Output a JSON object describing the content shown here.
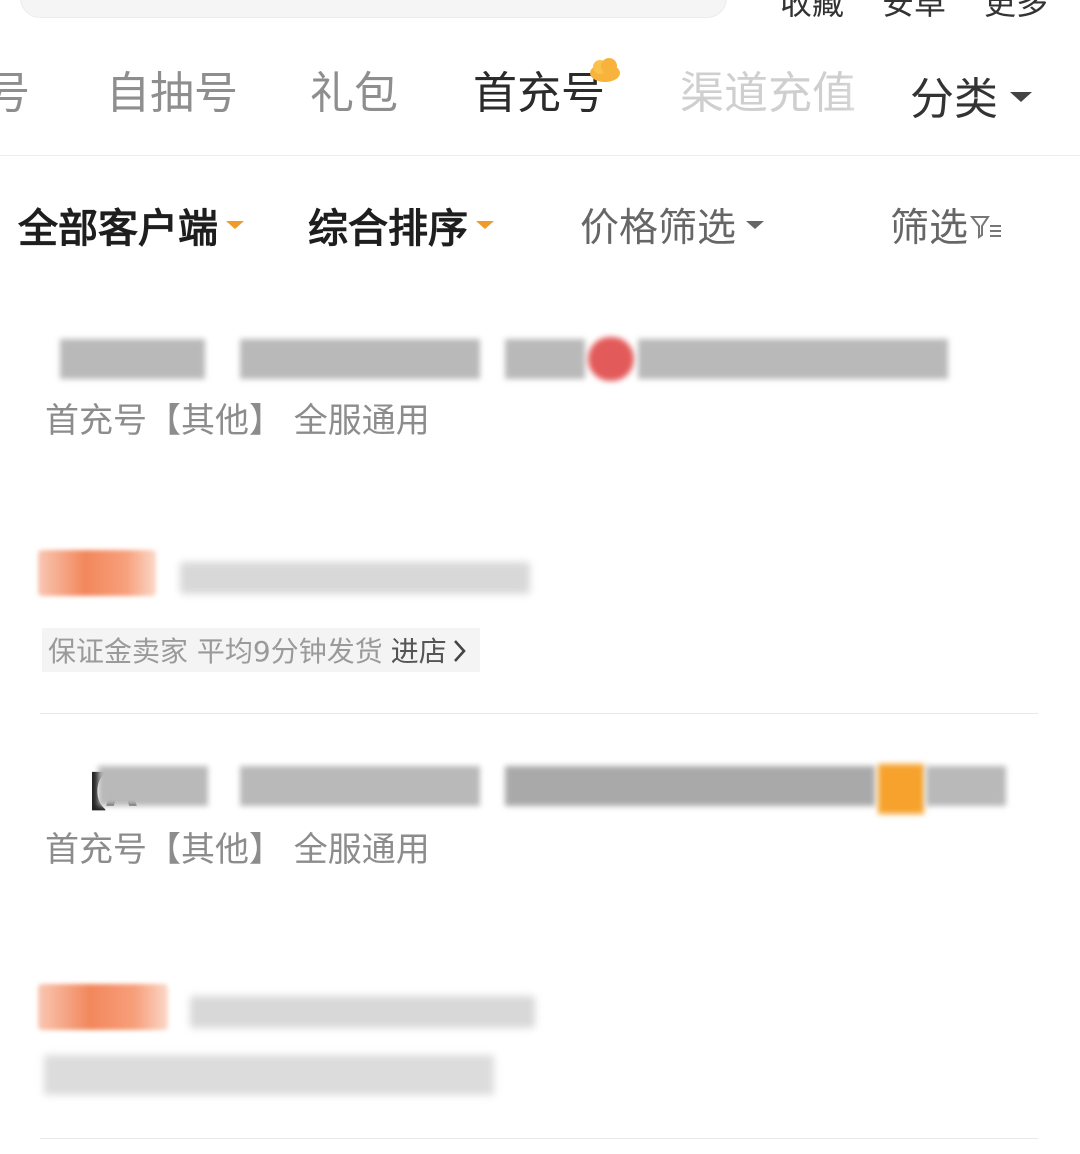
{
  "top_actions": [
    "收藏",
    "安卓",
    "更多"
  ],
  "category_tabs": [
    {
      "label": "号",
      "state": "inactive"
    },
    {
      "label": "自抽号",
      "state": "inactive"
    },
    {
      "label": "礼包",
      "state": "inactive"
    },
    {
      "label": "首充号",
      "state": "active",
      "badge_icon": "hot-cloud-icon"
    },
    {
      "label": "渠道充值",
      "state": "faded"
    }
  ],
  "category_menu": {
    "label": "分类"
  },
  "filters": {
    "client": "全部客户端",
    "sort": "综合排序",
    "price": "价格筛选",
    "more": "筛选"
  },
  "listings": [
    {
      "title": "",
      "tags": "首充号【其他】 全服通用",
      "service": "保证金卖家 平均9分钟发货",
      "enter_shop": "进店"
    },
    {
      "title_prefix": "【A",
      "tags": "首充号【其他】 全服通用",
      "service": "",
      "enter_shop": ""
    }
  ],
  "colors": {
    "accent_orange": "#f19a2a",
    "seller_orange": "#f2875c",
    "text_primary": "#222222",
    "text_secondary": "#8c8c8c"
  }
}
